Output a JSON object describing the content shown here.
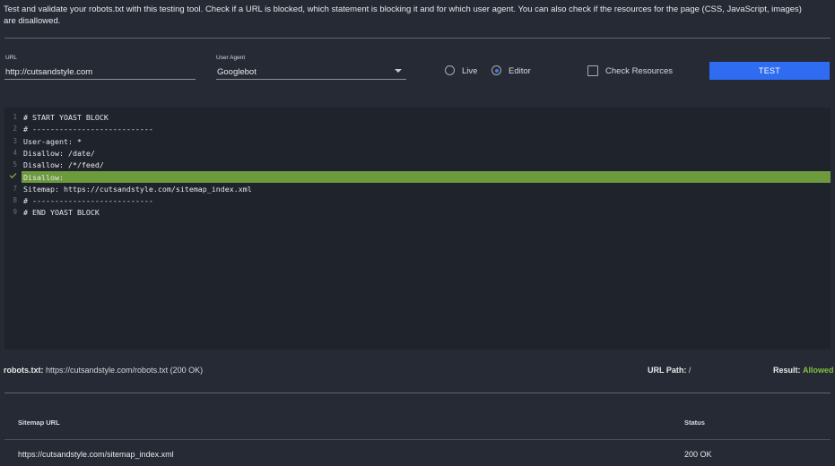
{
  "intro_text": "Test and validate your robots.txt with this testing tool. Check if a URL is blocked, which statement is blocking it and for which user agent. You can also check if the resources for the page (CSS, JavaScript, images) are disallowed.",
  "form": {
    "url_label": "URL",
    "url_value": "http://cutsandstyle.com",
    "user_agent_label": "User Agent",
    "user_agent_value": "Googlebot",
    "live_label": "Live",
    "editor_label": "Editor",
    "selected_mode": "Editor",
    "check_resources_label": "Check Resources",
    "check_resources_checked": false,
    "test_button_label": "TEST"
  },
  "editor": {
    "highlighted_line": 6,
    "lines": [
      {
        "num": "1",
        "text": "# START YOAST BLOCK"
      },
      {
        "num": "2",
        "text": "# ---------------------------"
      },
      {
        "num": "3",
        "text": "User-agent: *"
      },
      {
        "num": "4",
        "text": "Disallow: /date/"
      },
      {
        "num": "5",
        "text": "Disallow: /*/feed/"
      },
      {
        "num": "",
        "text": "Disallow:"
      },
      {
        "num": "7",
        "text": "Sitemap: https://cutsandstyle.com/sitemap_index.xml"
      },
      {
        "num": "8",
        "text": "# ---------------------------"
      },
      {
        "num": "9",
        "text": "# END YOAST BLOCK"
      }
    ]
  },
  "results": {
    "robots_label": "robots.txt:",
    "robots_value": "https://cutsandstyle.com/robots.txt (200 OK)",
    "url_path_label": "URL Path:",
    "url_path_value": "/",
    "result_label": "Result:",
    "result_value": "Allowed",
    "allowed_color": "#7fc13f"
  },
  "sitemap_table": {
    "headers": [
      "Sitemap URL",
      "Status"
    ],
    "rows": [
      [
        "https://cutsandstyle.com/sitemap_index.xml",
        "200 OK"
      ]
    ]
  },
  "colors": {
    "background": "#252a34",
    "editor_background": "#1f232b",
    "highlight": "#6e9a3e",
    "accent": "#2f6cf2"
  }
}
